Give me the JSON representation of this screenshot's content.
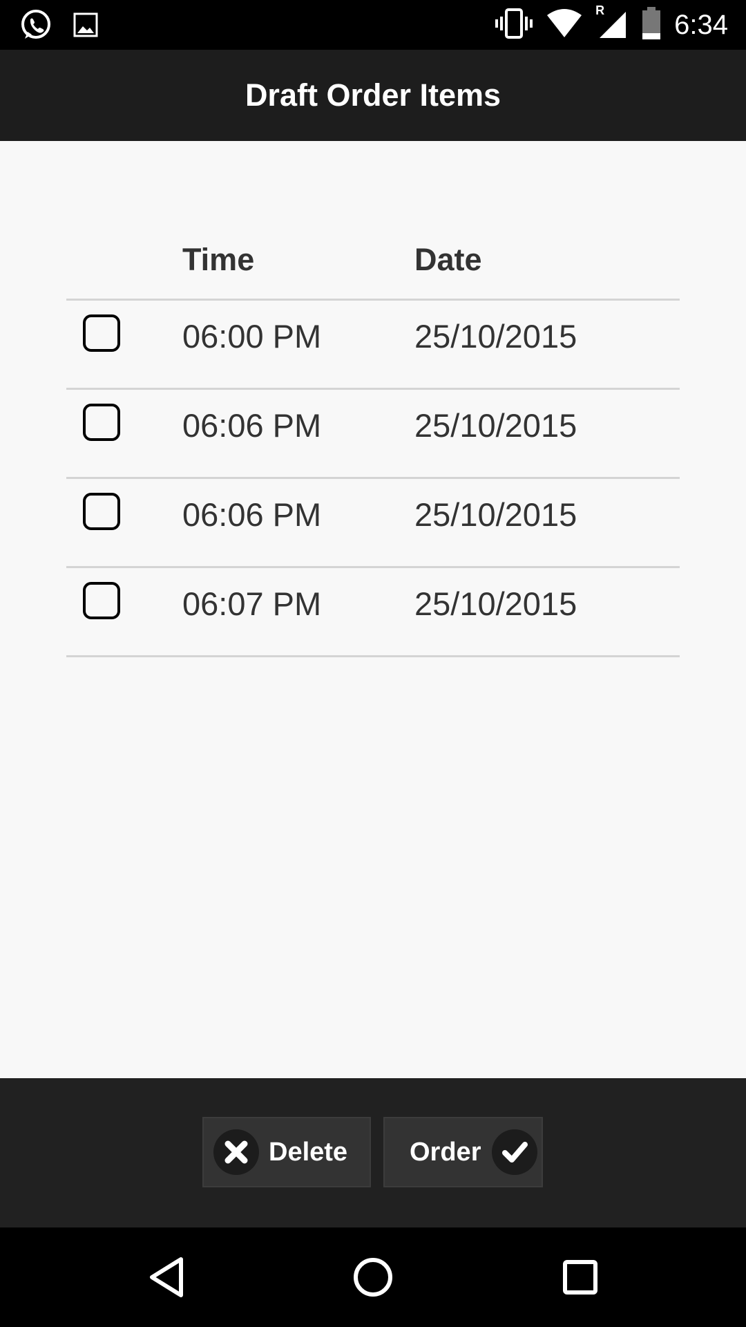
{
  "status_bar": {
    "time": "6:34",
    "left_icons": [
      "whatsapp-icon",
      "image-icon"
    ],
    "right_icons": [
      "vibrate-icon",
      "wifi-icon",
      "signal-roaming-icon",
      "battery-icon"
    ],
    "roaming_label": "R"
  },
  "app_bar": {
    "title": "Draft Order Items"
  },
  "table": {
    "headers": {
      "time": "Time",
      "date": "Date"
    },
    "rows": [
      {
        "time": "06:00 PM",
        "date": "25/10/2015",
        "checked": false
      },
      {
        "time": "06:06 PM",
        "date": "25/10/2015",
        "checked": false
      },
      {
        "time": "06:06 PM",
        "date": "25/10/2015",
        "checked": false
      },
      {
        "time": "06:07 PM",
        "date": "25/10/2015",
        "checked": false
      }
    ]
  },
  "actions": {
    "delete_label": "Delete",
    "delete_icon": "close-circle-icon",
    "order_label": "Order",
    "order_icon": "check-circle-icon"
  },
  "nav_bar": {
    "icons": [
      "back-icon",
      "home-icon",
      "recent-apps-icon"
    ]
  },
  "colors": {
    "app_bar": "#1d1d1d",
    "action_bar": "#212121",
    "button": "#333333",
    "background": "#f8f8f8",
    "divider": "#d4d4d4"
  }
}
